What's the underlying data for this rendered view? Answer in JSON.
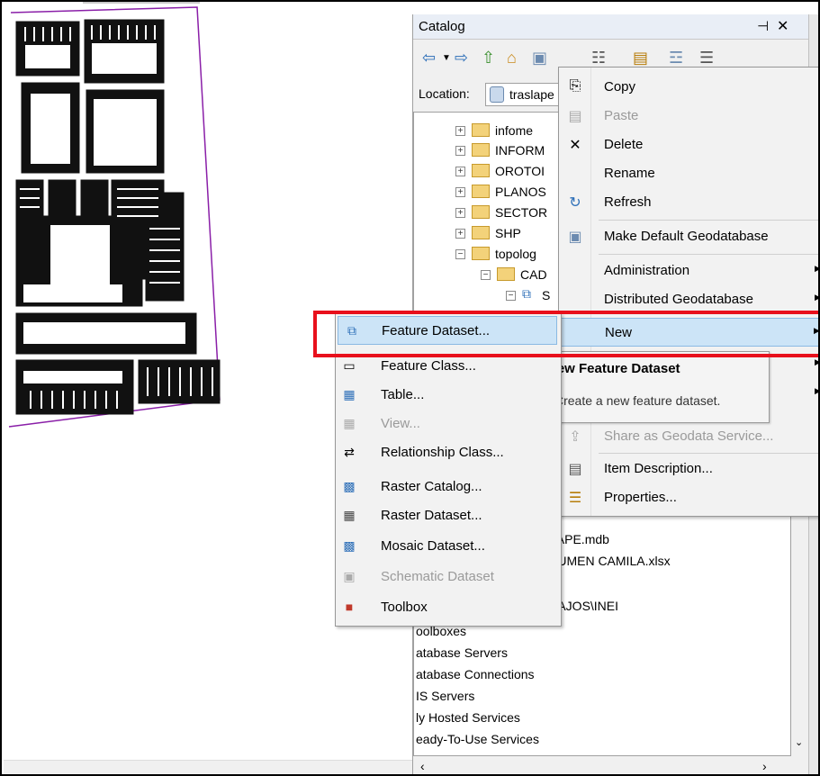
{
  "catalog": {
    "title": "Catalog",
    "pin": "⊣",
    "close": "✕",
    "location_label": "Location:",
    "location_value": "traslape"
  },
  "tree": {
    "items": [
      {
        "label": "infome",
        "state": "+"
      },
      {
        "label": "INFORM",
        "state": "+"
      },
      {
        "label": "OROTOI",
        "state": "+"
      },
      {
        "label": "PLANOS",
        "state": "+"
      },
      {
        "label": "SECTOR",
        "state": "+"
      },
      {
        "label": "SHP",
        "state": "+"
      },
      {
        "label": "topolog",
        "state": "−"
      },
      {
        "label": "CAD",
        "state": "−"
      },
      {
        "label": "S",
        "state": "−"
      }
    ],
    "files": [
      {
        "label": "LAPE.mdb"
      },
      {
        "label": "SUMEN CAMILA.xlsx"
      },
      {
        "label": "BAJOS\\INEI"
      }
    ],
    "bottom": [
      {
        "label": "oolboxes"
      },
      {
        "label": "atabase Servers"
      },
      {
        "label": "atabase Connections"
      },
      {
        "label": "IS Servers"
      },
      {
        "label": "ly Hosted Services"
      },
      {
        "label": "eady-To-Use Services"
      }
    ]
  },
  "context_menu": {
    "items": [
      {
        "label": "Copy",
        "icon": "copy-icon"
      },
      {
        "label": "Paste",
        "icon": "paste-icon"
      },
      {
        "label": "Delete",
        "icon": "delete-icon"
      },
      {
        "label": "Rename",
        "icon": ""
      },
      {
        "label": "Refresh",
        "icon": "refresh-icon"
      },
      {
        "label": "Make Default Geodatabase",
        "icon": "geodatabase-icon"
      },
      {
        "label": "Administration",
        "icon": ""
      },
      {
        "label": "Distributed Geodatabase",
        "icon": ""
      },
      {
        "label": "New",
        "icon": ""
      },
      {
        "label": "Share as Geodata Service...",
        "icon": "share-icon"
      },
      {
        "label": "Item Description...",
        "icon": "item-description-icon"
      },
      {
        "label": "Properties...",
        "icon": "properties-icon"
      }
    ]
  },
  "submenu": {
    "items": [
      {
        "label": "Feature Dataset..."
      },
      {
        "label": "Feature Class..."
      },
      {
        "label": "Table..."
      },
      {
        "label": "View..."
      },
      {
        "label": "Relationship Class..."
      },
      {
        "label": "Raster Catalog..."
      },
      {
        "label": "Raster Dataset..."
      },
      {
        "label": "Mosaic Dataset..."
      },
      {
        "label": "Schematic Dataset"
      },
      {
        "label": "Toolbox"
      }
    ]
  },
  "tooltip": {
    "title": "New Feature Dataset",
    "description": "Create a new feature dataset."
  },
  "colors": {
    "highlight_box": "#e8101c",
    "menu_hover": "#cce4f7"
  }
}
